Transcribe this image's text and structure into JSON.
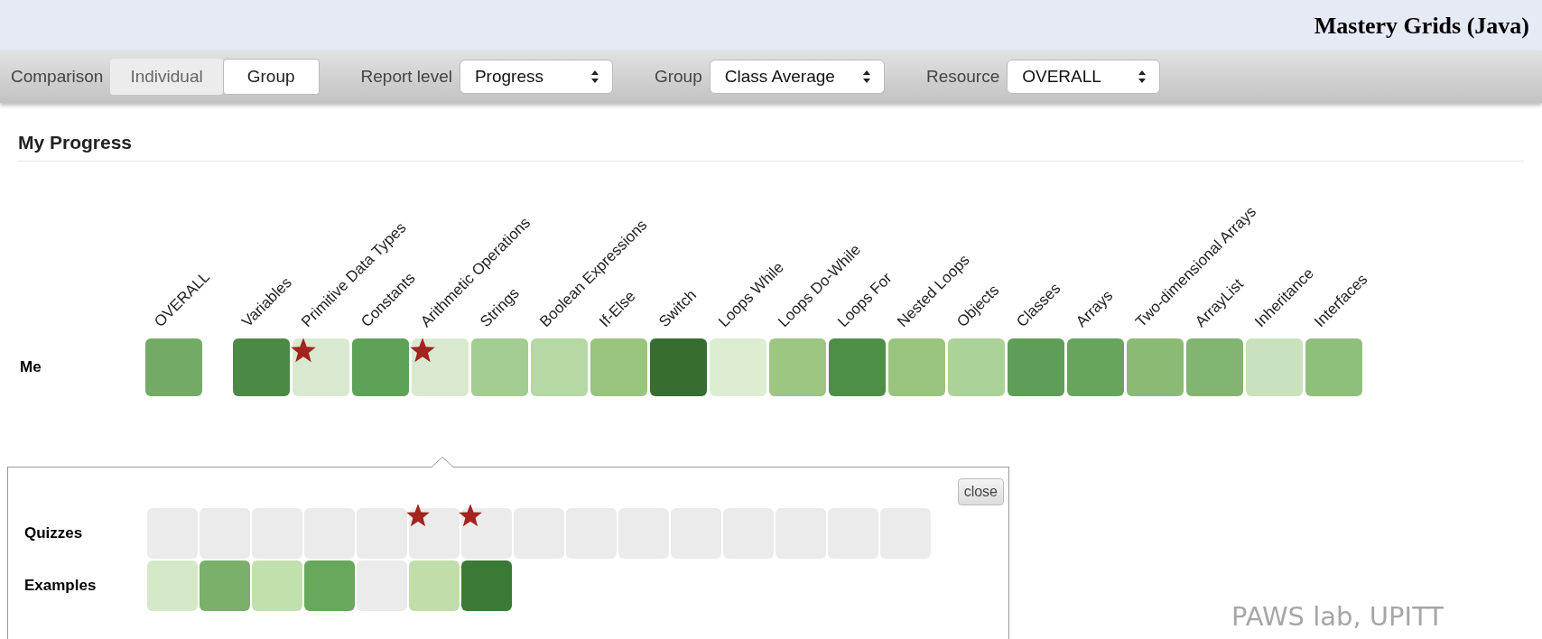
{
  "header": {
    "title": "Mastery Grids (Java)"
  },
  "toolbar": {
    "comparison": {
      "label": "Comparison",
      "options": [
        {
          "label": "Individual",
          "selected": false
        },
        {
          "label": "Group",
          "selected": true
        }
      ]
    },
    "dropdowns": [
      {
        "label": "Report level",
        "value": "Progress"
      },
      {
        "label": "Group",
        "value": "Class Average"
      },
      {
        "label": "Resource",
        "value": "OVERALL"
      }
    ]
  },
  "section": {
    "title": "My Progress"
  },
  "grid": {
    "row_label": "Me",
    "overall": {
      "label": "OVERALL",
      "color": "#72ab66",
      "starred": false
    },
    "topics": [
      {
        "label": "Variables",
        "color": "#4b8a45",
        "starred": false
      },
      {
        "label": "Primitive Data Types",
        "color": "#d9e9cf",
        "starred": true
      },
      {
        "label": "Constants",
        "color": "#5ea257",
        "starred": false
      },
      {
        "label": "Arithmetic Operations",
        "color": "#d9e9cf",
        "starred": true
      },
      {
        "label": "Strings",
        "color": "#a3cc90",
        "starred": false
      },
      {
        "label": "Boolean Expressions",
        "color": "#b5d8a4",
        "starred": false
      },
      {
        "label": "If-Else",
        "color": "#99c47e",
        "starred": false
      },
      {
        "label": "Switch",
        "color": "#366e30",
        "starred": false
      },
      {
        "label": "Loops While",
        "color": "#dcedd2",
        "starred": false
      },
      {
        "label": "Loops Do-While",
        "color": "#9cc681",
        "starred": false
      },
      {
        "label": "Loops For",
        "color": "#4e8f47",
        "starred": false
      },
      {
        "label": "Nested Loops",
        "color": "#99c47e",
        "starred": false
      },
      {
        "label": "Objects",
        "color": "#abd399",
        "starred": false
      },
      {
        "label": "Classes",
        "color": "#5f9e58",
        "starred": false
      },
      {
        "label": "Arrays",
        "color": "#66a55b",
        "starred": false
      },
      {
        "label": "Two-dimensional Arrays",
        "color": "#8aba74",
        "starred": false
      },
      {
        "label": "ArrayList",
        "color": "#82b571",
        "starred": false
      },
      {
        "label": "Inheritance",
        "color": "#c9e2bd",
        "starred": false
      },
      {
        "label": "Interfaces",
        "color": "#8fc07b",
        "starred": false
      }
    ]
  },
  "popup": {
    "close": "close",
    "rows": [
      {
        "label": "Quizzes",
        "cells": [
          {
            "color": "#ebebeb",
            "starred": false
          },
          {
            "color": "#ebebeb",
            "starred": false
          },
          {
            "color": "#ebebeb",
            "starred": false
          },
          {
            "color": "#ebebeb",
            "starred": false
          },
          {
            "color": "#ebebeb",
            "starred": false
          },
          {
            "color": "#ebebeb",
            "starred": true
          },
          {
            "color": "#ebebeb",
            "starred": true
          },
          {
            "color": "#ebebeb",
            "starred": false
          },
          {
            "color": "#ebebeb",
            "starred": false
          },
          {
            "color": "#ebebeb",
            "starred": false
          },
          {
            "color": "#ebebeb",
            "starred": false
          },
          {
            "color": "#ebebeb",
            "starred": false
          },
          {
            "color": "#ebebeb",
            "starred": false
          },
          {
            "color": "#ebebeb",
            "starred": false
          },
          {
            "color": "#ebebeb",
            "starred": false
          }
        ]
      },
      {
        "label": "Examples",
        "cells": [
          {
            "color": "#d5e8c8",
            "starred": false
          },
          {
            "color": "#7ab06a",
            "starred": false
          },
          {
            "color": "#c2dfae",
            "starred": false
          },
          {
            "color": "#68a85c",
            "starred": false
          },
          {
            "color": "#ebebeb",
            "starred": false
          },
          {
            "color": "#c1dda9",
            "starred": false
          },
          {
            "color": "#3b7a35",
            "starred": false
          }
        ]
      }
    ]
  },
  "caption": "PAWS lab, UPITT"
}
